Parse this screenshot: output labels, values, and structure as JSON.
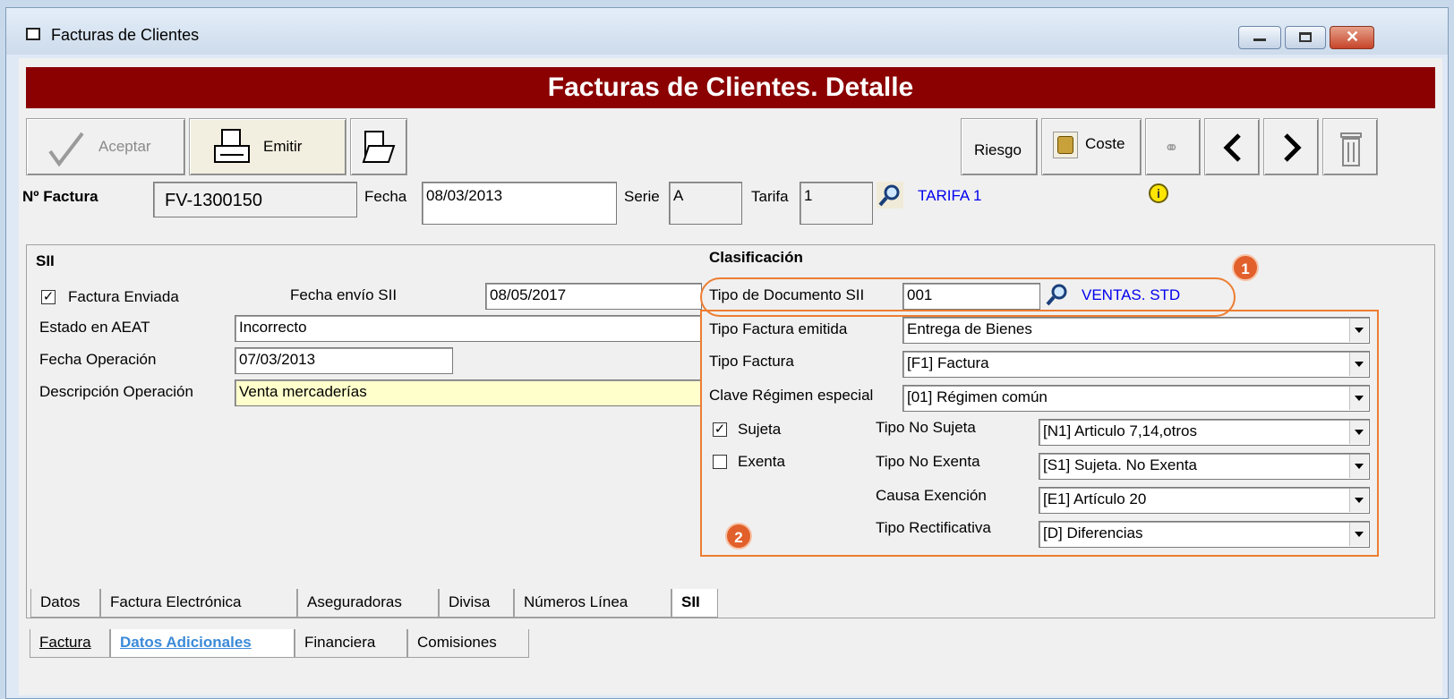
{
  "window": {
    "title": "Facturas de Clientes"
  },
  "header": {
    "title": "Facturas de Clientes. Detalle"
  },
  "toolbar": {
    "aceptar": "Aceptar",
    "emitir": "Emitir",
    "riesgo": "Riesgo",
    "coste": "Coste"
  },
  "invoice": {
    "numero_label": "Nº Factura",
    "numero": "FV-1300150",
    "fecha_label": "Fecha",
    "fecha": "08/03/2013",
    "serie_label": "Serie",
    "serie": "A",
    "tarifa_label": "Tarifa",
    "tarifa": "1",
    "tarifa_name": "TARIFA 1"
  },
  "sii": {
    "section_title": "SII",
    "factura_enviada_label": "Factura Enviada",
    "factura_enviada_checked": true,
    "fecha_envio_label": "Fecha envío SII",
    "fecha_envio": "08/05/2017",
    "estado_label": "Estado en AEAT",
    "estado": "Incorrecto",
    "fecha_operacion_label": "Fecha Operación",
    "fecha_operacion": "07/03/2013",
    "descripcion_label": "Descripción Operación",
    "descripcion": "Venta mercaderías"
  },
  "clasificacion": {
    "title": "Clasificación",
    "tipo_documento_label": "Tipo de Documento SII",
    "tipo_documento": "001",
    "tipo_documento_name": "VENTAS. STD",
    "tipo_factura_emitida_label": "Tipo Factura emitida",
    "tipo_factura_emitida": "Entrega de Bienes",
    "tipo_factura_label": "Tipo Factura",
    "tipo_factura": "[F1] Factura",
    "clave_regimen_label": "Clave Régimen especial",
    "clave_regimen": "[01] Régimen común",
    "sujeta_label": "Sujeta",
    "sujeta_checked": true,
    "exenta_label": "Exenta",
    "exenta_checked": false,
    "tipo_no_sujeta_label": "Tipo No Sujeta",
    "tipo_no_sujeta": "[N1] Articulo 7,14,otros",
    "tipo_no_exenta_label": "Tipo No Exenta",
    "tipo_no_exenta": "[S1] Sujeta. No Exenta",
    "causa_exencion_label": "Causa Exención",
    "causa_exencion": "[E1] Artículo 20",
    "tipo_rectificativa_label": "Tipo Rectificativa",
    "tipo_rectificativa": "[D] Diferencias"
  },
  "callouts": {
    "badge1": "1",
    "badge2": "2"
  },
  "inner_tabs": [
    "Datos",
    "Factura Electrónica",
    "Aseguradoras",
    "Divisa",
    "Números Línea",
    "SII"
  ],
  "outer_tabs": [
    "Factura",
    "Datos Adicionales",
    "Financiera",
    "Comisiones"
  ],
  "colors": {
    "header_bg": "#8b0000",
    "callout": "#ed7d31",
    "link": "#0000ee"
  }
}
